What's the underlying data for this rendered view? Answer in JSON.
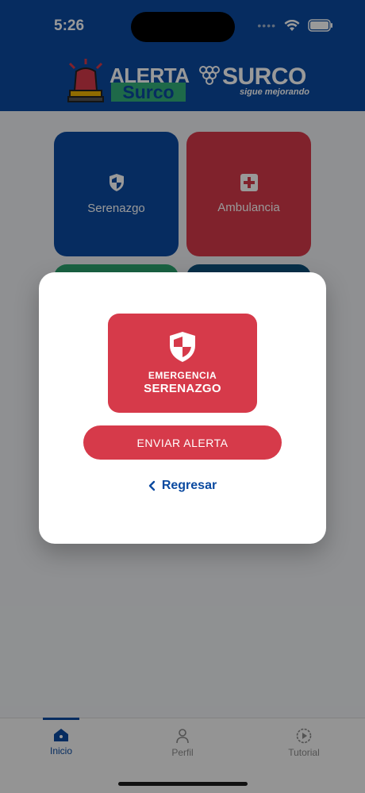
{
  "status_bar": {
    "time": "5:26"
  },
  "header": {
    "logo_alerta": "ALERTA",
    "logo_surco": "Surco",
    "brand_name": "SURCO",
    "brand_tagline": "sigue mejorando"
  },
  "grid": {
    "tiles": [
      {
        "label": "Serenazgo",
        "icon": "shield-icon",
        "color": "#0b4aa0"
      },
      {
        "label": "Ambulancia",
        "icon": "medical-cross-icon",
        "color": "#d63a4a"
      }
    ]
  },
  "modal": {
    "emergency_line1": "EMERGENCIA",
    "emergency_line2": "SERENAZGO",
    "send_label": "ENVIAR ALERTA",
    "back_label": "Regresar"
  },
  "nav": {
    "items": [
      {
        "label": "Inicio",
        "icon": "home-icon",
        "active": true
      },
      {
        "label": "Perfil",
        "icon": "person-icon",
        "active": false
      },
      {
        "label": "Tutorial",
        "icon": "play-circle-icon",
        "active": false
      }
    ]
  },
  "colors": {
    "brand_blue": "#0b4aa0",
    "alert_red": "#d63a4a",
    "accent_green": "#33b07a"
  }
}
